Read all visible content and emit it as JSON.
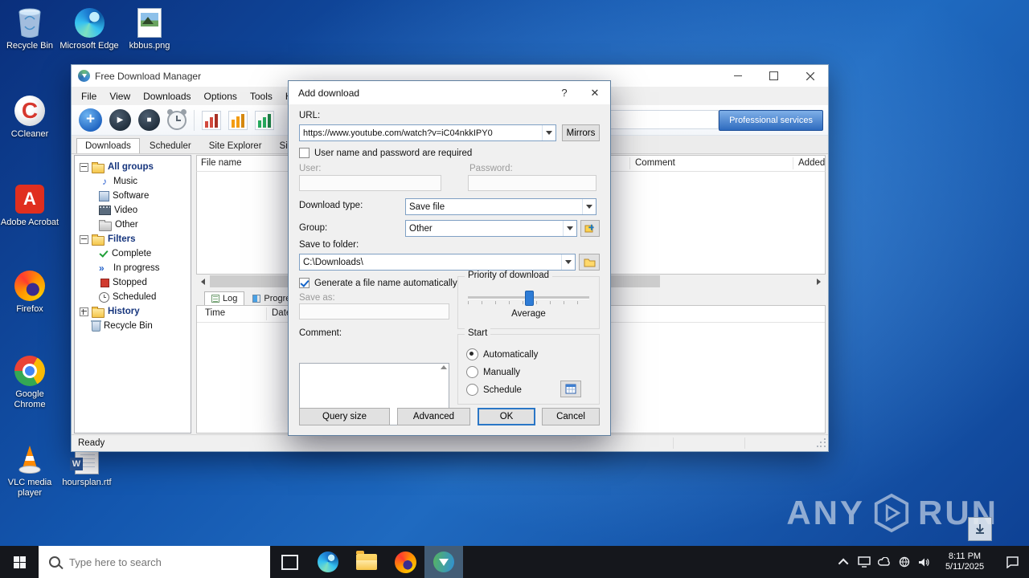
{
  "icons": {
    "add": "+",
    "play": "▶",
    "stop": "■",
    "music": "♪",
    "inprogress": "»",
    "close": "✕",
    "help": "?",
    "ccleaner": "C",
    "acrobat": "A",
    "word": "W"
  },
  "desktop": {
    "icons": [
      {
        "label": "Recycle Bin"
      },
      {
        "label": "Microsoft Edge"
      },
      {
        "label": "kbbus.png"
      },
      {
        "label": "CCleaner"
      },
      {
        "label": "Adobe Acrobat"
      },
      {
        "label": "Firefox"
      },
      {
        "label": "Google Chrome"
      },
      {
        "label": "VLC media player"
      },
      {
        "label": "hoursplan.rtf"
      }
    ]
  },
  "window": {
    "title": "Free Download Manager",
    "menu": [
      "File",
      "View",
      "Downloads",
      "Options",
      "Tools",
      "Help"
    ],
    "toolbar": {
      "professional_services": "Professional services"
    },
    "tabs": [
      "Downloads",
      "Scheduler",
      "Site Explorer",
      "Site Manager"
    ],
    "tree": {
      "all_groups": "All groups",
      "groups": [
        "Music",
        "Software",
        "Video",
        "Other"
      ],
      "filters": "Filters",
      "filter_items": [
        "Complete",
        "In progress",
        "Stopped",
        "Scheduled"
      ],
      "history": "History",
      "recycle_bin": "Recycle Bin"
    },
    "list_columns": {
      "file_name": "File name",
      "comment": "Comment",
      "added": "Added"
    },
    "bottom": {
      "tabs": [
        "Log",
        "Progress"
      ],
      "columns": [
        "Time",
        "Date"
      ]
    },
    "status": "Ready"
  },
  "dialog": {
    "title": "Add download",
    "url": {
      "label": "URL:",
      "value": "https://www.youtube.com/watch?v=iC04nkkIPY0",
      "mirrors": "Mirrors"
    },
    "auth": {
      "checkbox": "User name and password are required",
      "user": "User:",
      "password": "Password:"
    },
    "download_type": {
      "label": "Download type:",
      "value": "Save file"
    },
    "group": {
      "label": "Group:",
      "value": "Other"
    },
    "save_to": {
      "label": "Save to folder:",
      "value": "C:\\Downloads\\"
    },
    "autoname": "Generate a file name automatically",
    "save_as": "Save as:",
    "comment": "Comment:",
    "priority": {
      "label": "Priority of download",
      "value": "Average"
    },
    "start": {
      "label": "Start",
      "options": [
        "Automatically",
        "Manually",
        "Schedule"
      ]
    },
    "buttons": {
      "query": "Query size",
      "advanced": "Advanced",
      "ok": "OK",
      "cancel": "Cancel"
    }
  },
  "taskbar": {
    "search_placeholder": "Type here to search",
    "clock": {
      "time": "8:11 PM",
      "date": "5/11/2025"
    }
  },
  "watermark": {
    "any": "ANY",
    "run": "RUN"
  }
}
